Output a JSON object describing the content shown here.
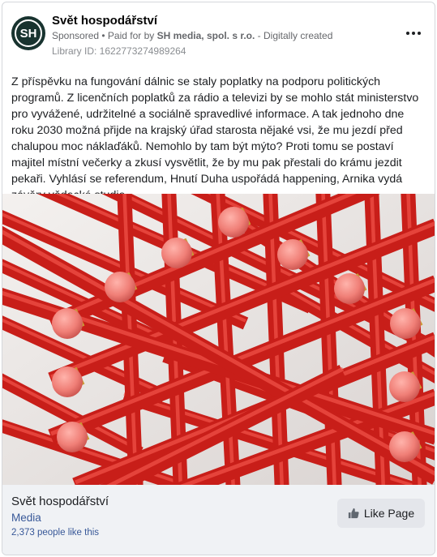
{
  "header": {
    "avatar_text": "SH",
    "page_name": "Svět hospodářství",
    "sponsored_label": "Sponsored",
    "separator": " • ",
    "paid_for_prefix": "Paid for by ",
    "paid_for_name": "SH media, spol. s r.o.",
    "created_suffix": " - Digitally created",
    "library_id": "Library ID: 1622773274989264",
    "more_icon": "more-horizontal-icon"
  },
  "post": {
    "text": "Z příspěvku na fungování dálnic se staly poplatky na podporu politických programů. Z licenčních poplatků za rádio a televizi by se mohlo stát ministerstvo pro vyvážené, udržitelné a sociálně spravedlivé informace. A tak jednoho dne roku 2030 možná přijde na krajský úřad starosta nějaké vsi, že mu jezdí před chalupou moc náklaďáků. Nemohlo by tam být mýto? Proti tomu se postaví majitel místní večerky a zkusí vysvětlit, že by mu pak přestali do krámu jezdit pekaři. Vyhlásí se referendum, Hnutí Duha uspořádá happening, Arnika vydá závěry vědecké studie,…",
    "image_subject": "crossed red pencils with pink erasers"
  },
  "footer": {
    "page_name": "Svět hospodářství",
    "category": "Media",
    "likes": "2,373 people like this",
    "like_button": "Like Page",
    "like_icon": "thumbs-up-icon"
  },
  "colors": {
    "avatar_bg": "#18332f",
    "link": "#385898",
    "footer_bg": "#f0f2f5",
    "pencil_red": "#d8211c",
    "eraser_pink": "#f0807a",
    "ferrule_gold": "#c99a35"
  }
}
